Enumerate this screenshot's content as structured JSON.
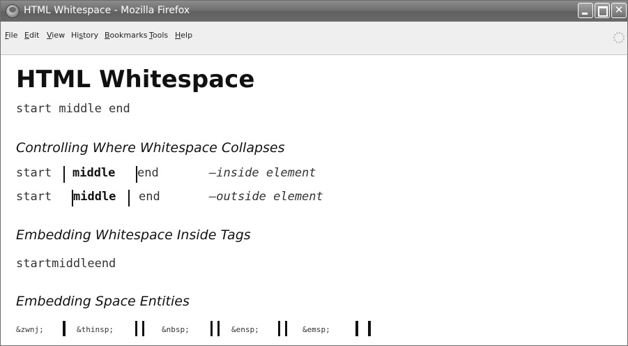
{
  "window": {
    "title": "HTML Whitespace - Mozilla Firefox"
  },
  "menu": [
    "File",
    "Edit",
    "View",
    "History",
    "Bookmarks",
    "Tools",
    "Help"
  ],
  "menu_underline": [
    "F",
    "E",
    "V",
    "s",
    "B",
    "T",
    "H"
  ],
  "page": {
    "heading": "HTML Whitespace",
    "line1": "start middle end",
    "section1": {
      "heading": "Controlling Where Whitespace Collapses",
      "row1": {
        "start": "start",
        "middle": "middle",
        "end": "end",
        "dash_note": "—inside element"
      },
      "row2": {
        "start": "start",
        "middle": "middle",
        "end": "end",
        "dash_note": "—outside element"
      }
    },
    "section2": {
      "heading": "Embedding Whitespace Inside Tags",
      "text": "startmiddleend"
    },
    "section3": {
      "heading": "Embedding Space Entities",
      "entities": [
        "&zwnj;",
        "&thinsp;",
        "&nbsp;",
        "&ensp;",
        "&emsp;"
      ]
    }
  }
}
